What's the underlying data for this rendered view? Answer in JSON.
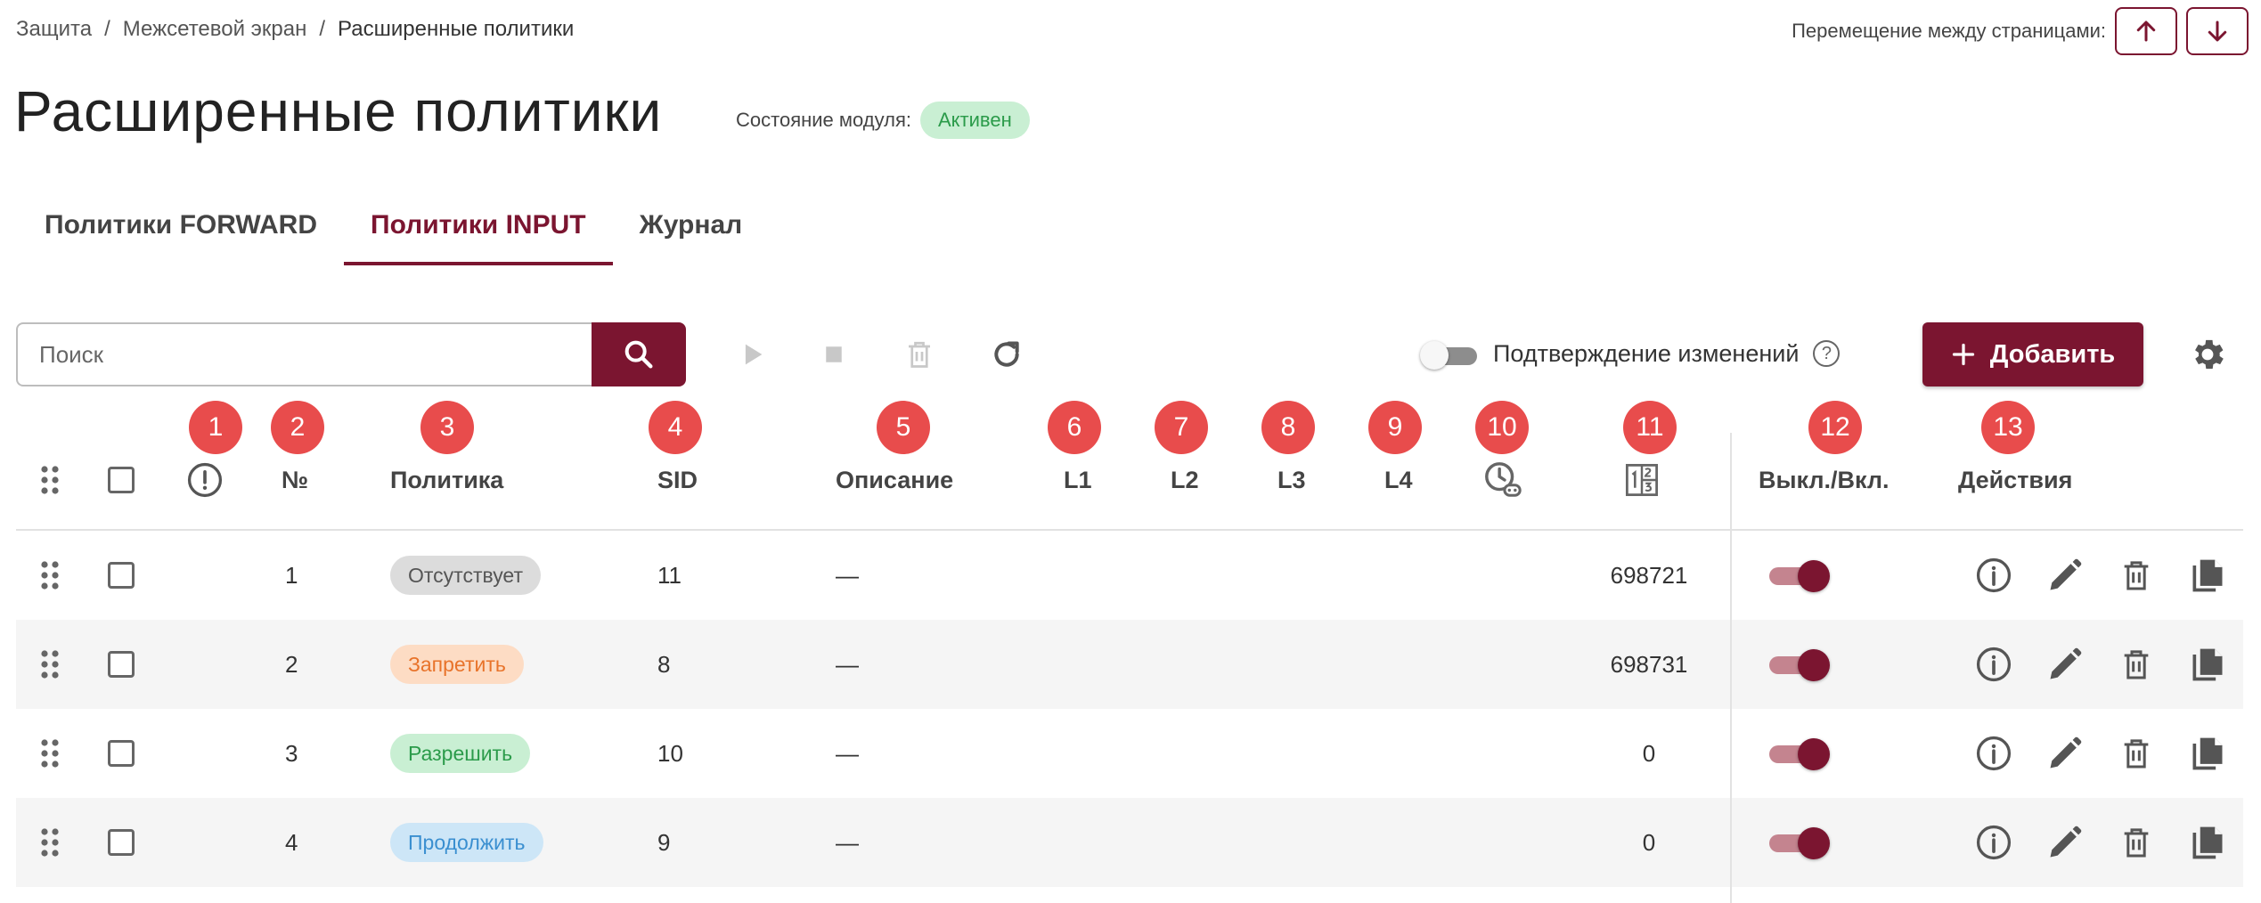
{
  "breadcrumb": [
    "Защита",
    "Межсетевой экран",
    "Расширенные политики"
  ],
  "page_nav": {
    "label": "Перемещение между страницами:",
    "up_icon": "arrow-up-icon",
    "down_icon": "arrow-down-icon"
  },
  "page": {
    "title": "Расширенные политики",
    "module_state_label": "Состояние модуля:",
    "module_state_value": "Активен"
  },
  "tabs": [
    {
      "label": "Политики FORWARD",
      "active": false
    },
    {
      "label": "Политики INPUT",
      "active": true
    },
    {
      "label": "Журнал",
      "active": false
    }
  ],
  "toolbar": {
    "search_placeholder": "Поиск",
    "confirm_changes_label": "Подтверждение изменений",
    "confirm_changes_enabled": false,
    "add_label": "Добавить"
  },
  "markers": [
    "1",
    "2",
    "3",
    "4",
    "5",
    "6",
    "7",
    "8",
    "9",
    "10",
    "11",
    "12",
    "13"
  ],
  "columns": {
    "num": "№",
    "policy": "Политика",
    "sid": "SID",
    "description": "Описание",
    "l1": "L1",
    "l2": "L2",
    "l3": "L3",
    "l4": "L4",
    "enabled": "Выкл./Вкл.",
    "actions": "Действия"
  },
  "rows": [
    {
      "num": "1",
      "policy": "Отсутствует",
      "sid": "11",
      "description": "—",
      "counter": "698721",
      "enabled": true
    },
    {
      "num": "2",
      "policy": "Запретить",
      "sid": "8",
      "description": "—",
      "counter": "698731",
      "enabled": true
    },
    {
      "num": "3",
      "policy": "Разрешить",
      "sid": "10",
      "description": "—",
      "counter": "0",
      "enabled": true
    },
    {
      "num": "4",
      "policy": "Продолжить",
      "sid": "9",
      "description": "—",
      "counter": "0",
      "enabled": true
    }
  ],
  "colors": {
    "accent": "#7b1530",
    "marker": "#e84c4c",
    "policy_none": {
      "bg": "#dcdcdc",
      "fg": "#555555"
    },
    "policy_deny": {
      "bg": "#fddcc4",
      "fg": "#e8732a"
    },
    "policy_allow": {
      "bg": "#c9efd3",
      "fg": "#2b9b4a"
    },
    "policy_continue": {
      "bg": "#cde6f7",
      "fg": "#3a8fd0"
    }
  }
}
